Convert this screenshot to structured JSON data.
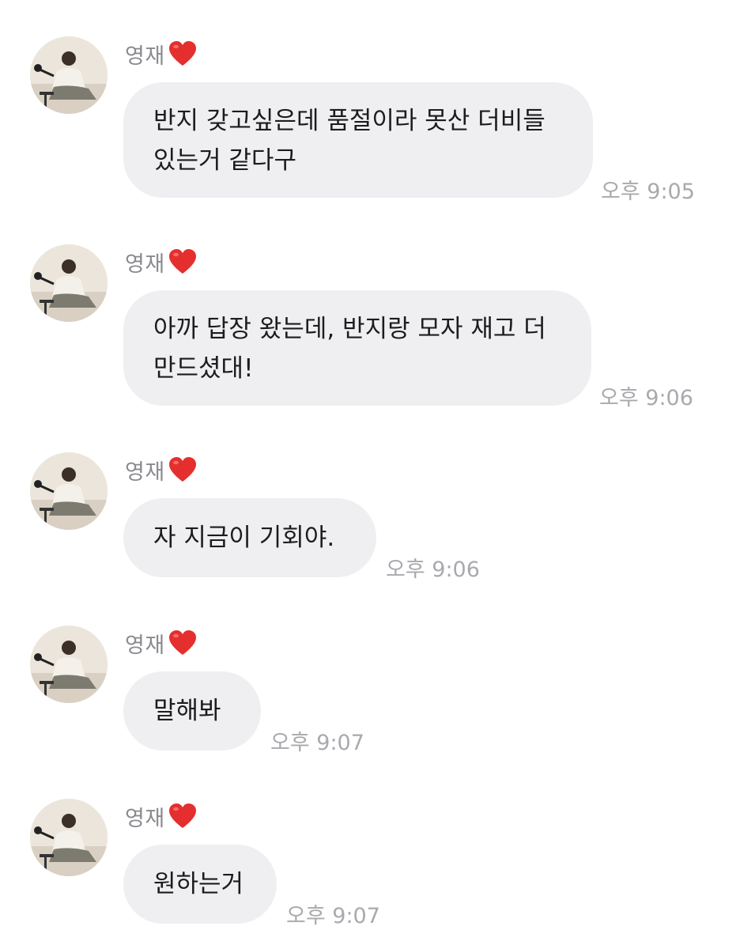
{
  "colors": {
    "background": "#ffffff",
    "bubble": "#efeff2",
    "sender_text": "#8a8a8e",
    "timestamp_text": "#a9a9ae",
    "message_text": "#1c1c1e",
    "heart": "#e52e2e"
  },
  "messages": [
    {
      "sender": "영재",
      "sender_icon": "red-heart-icon",
      "text": "반지 갖고싶은데 품절이라 못산 더비들\n있는거 같다구",
      "time": "오후 9:05"
    },
    {
      "sender": "영재",
      "sender_icon": "red-heart-icon",
      "text": "아까 답장 왔는데, 반지랑 모자 재고 더\n만드셨대!",
      "time": "오후 9:06"
    },
    {
      "sender": "영재",
      "sender_icon": "red-heart-icon",
      "text": "자 지금이 기회야.",
      "time": "오후 9:06"
    },
    {
      "sender": "영재",
      "sender_icon": "red-heart-icon",
      "text": "말해봐",
      "time": "오후 9:07"
    },
    {
      "sender": "영재",
      "sender_icon": "red-heart-icon",
      "text": "원하는거",
      "time": "오후 9:07"
    }
  ]
}
